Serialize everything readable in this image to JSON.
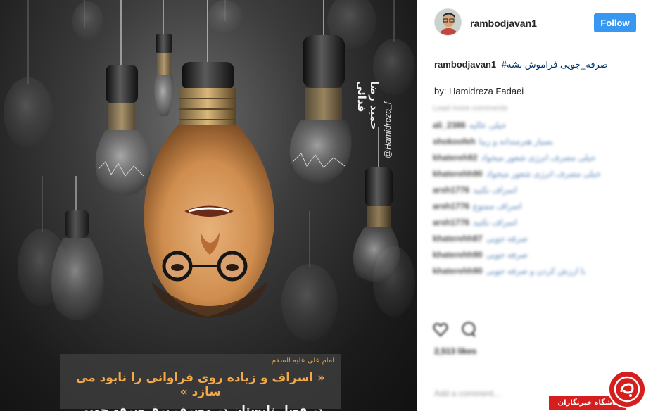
{
  "post": {
    "username": "rambodjavan1",
    "follow_label": "Follow",
    "caption_user": "rambodjavan1",
    "caption_hashtag": "صرفه_جویی فراموش نشه#",
    "credit": "by: Hamidreza Fadaei"
  },
  "artwork": {
    "artist_signature": "حمید رضا فدائی",
    "artist_handle": "@Hamidreza_f",
    "quote_attribution": "امام علی علیه السلام",
    "quote_main": "« اسراف و زیاده روی فراوانی را نابود می سازد »",
    "quote_sub": "در فصل تابستان در مصرف برق صرفه جویی کنیم ..."
  },
  "comments": {
    "load_more": "Load more comments",
    "items": [
      {
        "user": "ali_2386",
        "text": "خیلی عالیه"
      },
      {
        "user": "shokoofeh",
        "text": "بسیار هنرمندانه و زیبا"
      },
      {
        "user": "khatereh92",
        "text": "خیلی مصرف انرژی شعور میخواد"
      },
      {
        "user": "khaterehh90",
        "text": "خیلی مصرف انرژی شعور میخواد"
      },
      {
        "user": "arsh1776",
        "text": "اسراف نکنید"
      },
      {
        "user": "arsh1776",
        "text": "اسراف ممنوع"
      },
      {
        "user": "arsh1776",
        "text": "اسراف نکنید"
      },
      {
        "user": "khaterehh87",
        "text": "صرفه جویی"
      },
      {
        "user": "khaterehh90",
        "text": "صرفه جویی"
      },
      {
        "user": "khaterehh90",
        "text": "با ارزش کردن و صرفه جویی"
      }
    ]
  },
  "footer": {
    "likes": "2,513 likes",
    "add_comment": "Add a comment..."
  },
  "watermark": {
    "label": "باشگاه خبرنگاران"
  },
  "icons": {
    "like": "heart-icon",
    "comment": "comment-icon"
  },
  "colors": {
    "follow_bg": "#3897f0",
    "hashtag": "#003569",
    "watermark_red": "#d51f1f",
    "quote_orange": "#f2a94a"
  }
}
